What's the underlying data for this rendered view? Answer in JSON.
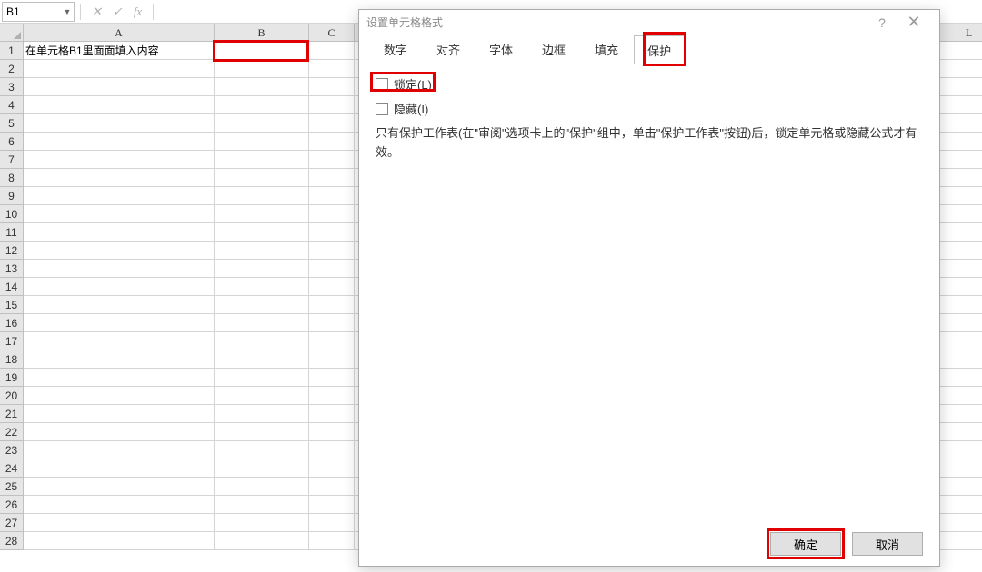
{
  "formula_bar": {
    "name_box": "B1",
    "icons": {
      "cancel": "✕",
      "confirm": "✓",
      "fx": "fx"
    }
  },
  "columns": [
    "A",
    "B",
    "C",
    "L"
  ],
  "cells": {
    "A1": "在单元格B1里面面填入内容"
  },
  "dialog": {
    "title": "设置单元格格式",
    "help": "?",
    "close": "✕",
    "tabs": {
      "number": "数字",
      "align": "对齐",
      "font": "字体",
      "border": "边框",
      "fill": "填充",
      "protect": "保护"
    },
    "protect": {
      "lock": "锁定(L)",
      "hide": "隐藏(I)",
      "note": "只有保护工作表(在\"审阅\"选项卡上的\"保护\"组中，单击\"保护工作表\"按钮)后，锁定单元格或隐藏公式才有效。"
    },
    "buttons": {
      "ok": "确定",
      "cancel": "取消"
    }
  }
}
